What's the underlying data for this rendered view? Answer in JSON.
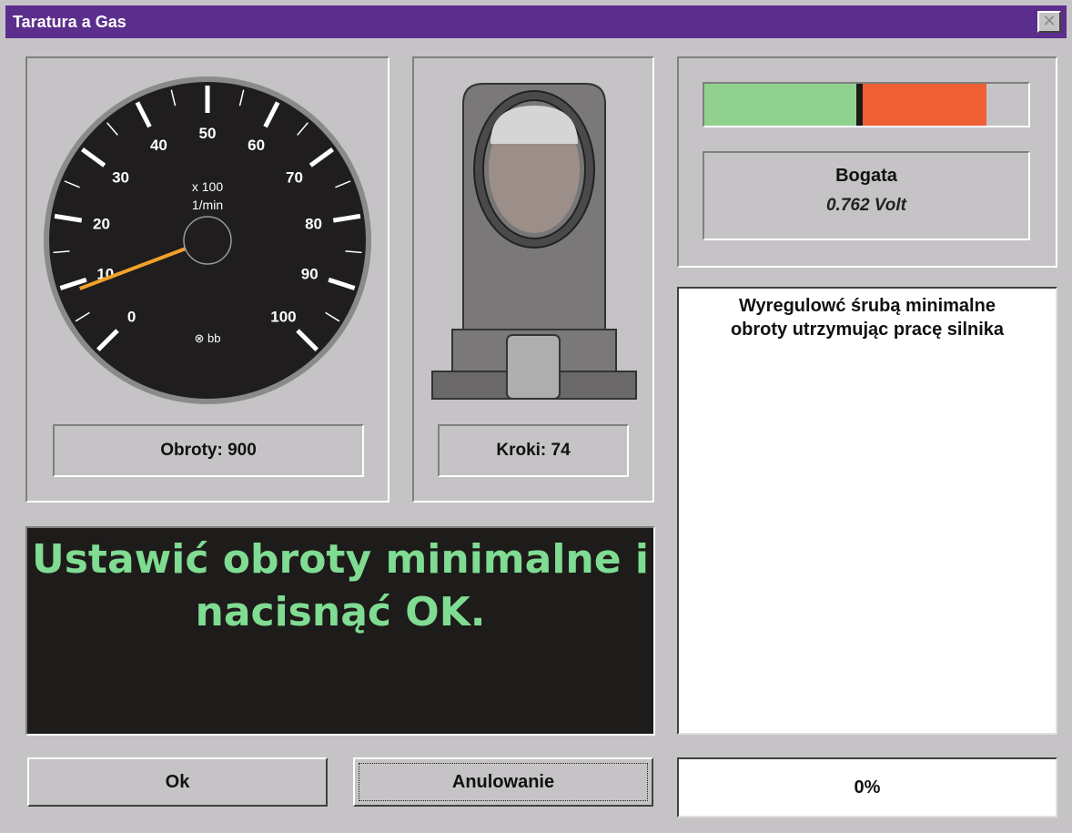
{
  "window": {
    "title": "Taratura a Gas",
    "close_symbol": "✕"
  },
  "gauge": {
    "tick_labels": [
      "0",
      "10",
      "20",
      "30",
      "40",
      "50",
      "60",
      "70",
      "80",
      "90",
      "100"
    ],
    "unit_multiplier": "x 100",
    "unit": "1/min",
    "brand": "⊗ bb",
    "needle_value": 9,
    "needle_color": "#f0a22a",
    "readout": "Obroty: 900"
  },
  "valve": {
    "icon": "stepper-valve-icon",
    "readout": "Kroki: 74"
  },
  "lambda": {
    "green_fraction": 0.47,
    "marker_fraction": 0.49,
    "red_end_fraction": 0.87,
    "green_color": "#90d18f",
    "red_color": "#f05f36",
    "mixture_label": "Bogata",
    "voltage": "0.762 Volt"
  },
  "message": {
    "line1": "Ustawić obroty minimalne i",
    "line2": "nacisnąć OK."
  },
  "instructions": {
    "line1": "Wyregulowć śrubą minimalne",
    "line2": "obroty utrzymując pracę silnika"
  },
  "buttons": {
    "ok_label": "Ok",
    "cancel_label": "Anulowanie"
  },
  "progress": {
    "text": "0%",
    "value": 0
  }
}
